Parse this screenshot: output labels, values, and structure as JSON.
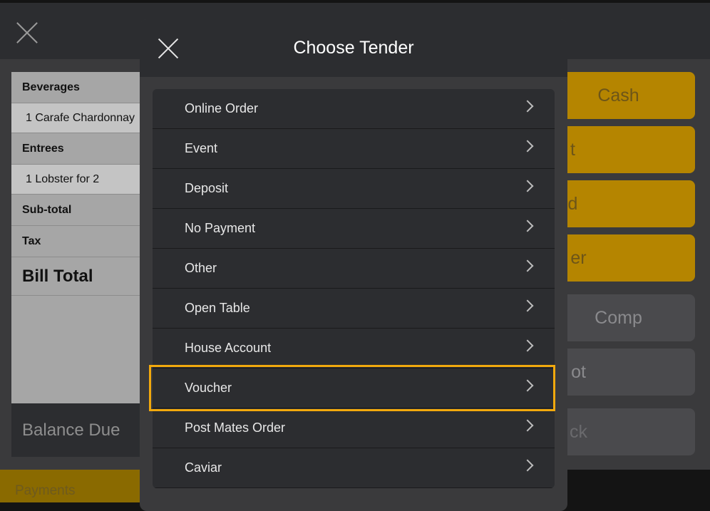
{
  "background": {
    "bill": {
      "rows": [
        {
          "text": "Beverages",
          "kind": "cat"
        },
        {
          "text": "1 Carafe Chardonnay",
          "kind": "item"
        },
        {
          "text": "Entrees",
          "kind": "cat"
        },
        {
          "text": "1 Lobster for 2",
          "kind": "item"
        },
        {
          "text": "Sub-total",
          "kind": "cat"
        },
        {
          "text": "Tax",
          "kind": "cat"
        },
        {
          "text": "Bill Total",
          "kind": "total"
        }
      ],
      "balance_label": "Balance Due"
    },
    "payments_label": "Payments",
    "tender_buttons": [
      {
        "label": "Cash",
        "visible_fragment": "Cash",
        "style": "gold"
      },
      {
        "label": "",
        "visible_fragment": "t",
        "style": "gold"
      },
      {
        "label": "",
        "visible_fragment": "d",
        "style": "gold"
      },
      {
        "label": "",
        "visible_fragment": "er",
        "style": "gold"
      },
      {
        "label": "Comp",
        "visible_fragment": "Comp",
        "style": "gray"
      },
      {
        "label": "",
        "visible_fragment": "ot",
        "style": "gray"
      },
      {
        "label": "",
        "visible_fragment": "ck",
        "style": "gray"
      }
    ]
  },
  "modal": {
    "title": "Choose Tender",
    "items": [
      {
        "label": "Online Order"
      },
      {
        "label": "Event"
      },
      {
        "label": "Deposit"
      },
      {
        "label": "No Payment"
      },
      {
        "label": "Other"
      },
      {
        "label": "Open Table"
      },
      {
        "label": "House Account"
      },
      {
        "label": "Voucher",
        "highlighted": true
      },
      {
        "label": "Post Mates Order"
      },
      {
        "label": "Caviar"
      }
    ]
  },
  "colors": {
    "highlight": "#f2a90d",
    "gold_button": "#b58500",
    "modal_bg": "#3a3a3c"
  },
  "icons": {
    "close": "close-icon",
    "chevron": "chevron-right-icon"
  }
}
